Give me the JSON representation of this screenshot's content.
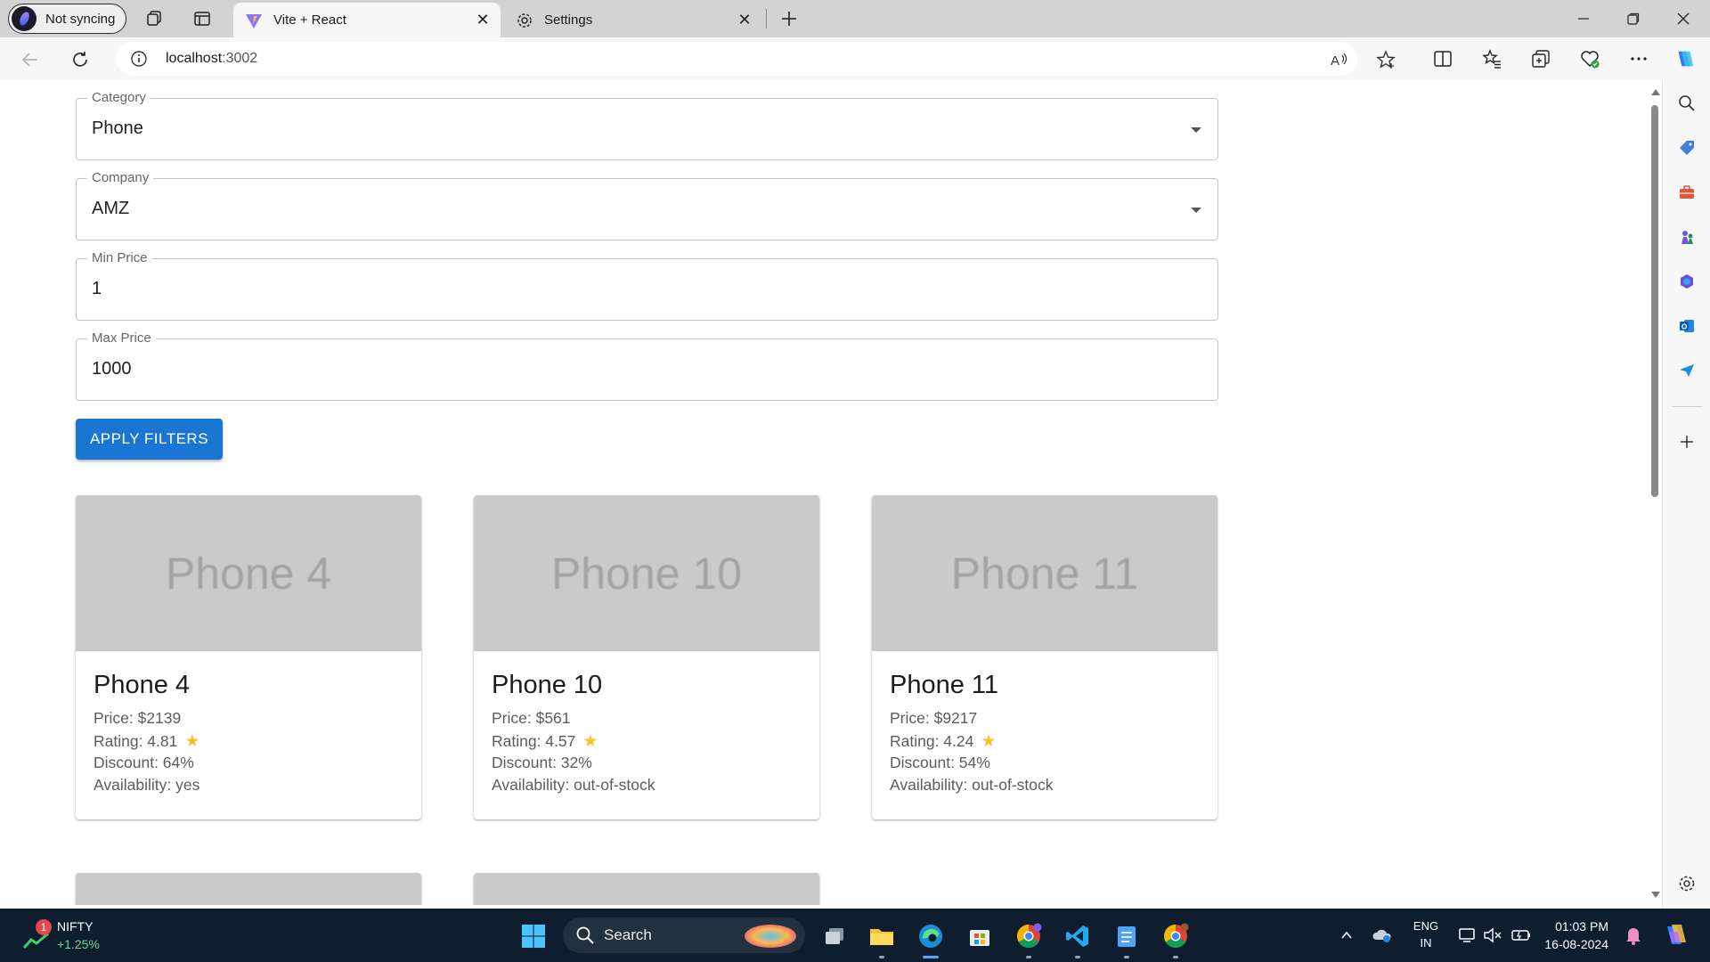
{
  "browser": {
    "profile_label": "Not syncing",
    "tabs": [
      {
        "label": "Vite + React",
        "active": true
      },
      {
        "label": "Settings",
        "active": false
      }
    ],
    "url_host": "localhost",
    "url_port": ":3002"
  },
  "filters": {
    "category": {
      "label": "Category",
      "value": "Phone"
    },
    "company": {
      "label": "Company",
      "value": "AMZ"
    },
    "min_price": {
      "label": "Min Price",
      "value": "1"
    },
    "max_price": {
      "label": "Max Price",
      "value": "1000"
    },
    "apply_label": "APPLY FILTERS"
  },
  "products": [
    {
      "image_text": "Phone 4",
      "name": "Phone 4",
      "price": "Price: $2139",
      "rating": "Rating: 4.81",
      "discount": "Discount: 64%",
      "availability": "Availability: yes"
    },
    {
      "image_text": "Phone 10",
      "name": "Phone 10",
      "price": "Price: $561",
      "rating": "Rating: 4.57",
      "discount": "Discount: 32%",
      "availability": "Availability: out-of-stock"
    },
    {
      "image_text": "Phone 11",
      "name": "Phone 11",
      "price": "Price: $9217",
      "rating": "Rating: 4.24",
      "discount": "Discount: 54%",
      "availability": "Availability: out-of-stock"
    }
  ],
  "taskbar": {
    "widget_badge": "1",
    "widget_name": "NIFTY",
    "widget_change": "+1.25%",
    "search_label": "Search",
    "lang_line1": "ENG",
    "lang_line2": "IN",
    "time": "01:03 PM",
    "date": "16-08-2024"
  },
  "colors": {
    "accent": "#1976d2",
    "star": "#fbc02d",
    "taskbar": "#0f1e2e"
  }
}
